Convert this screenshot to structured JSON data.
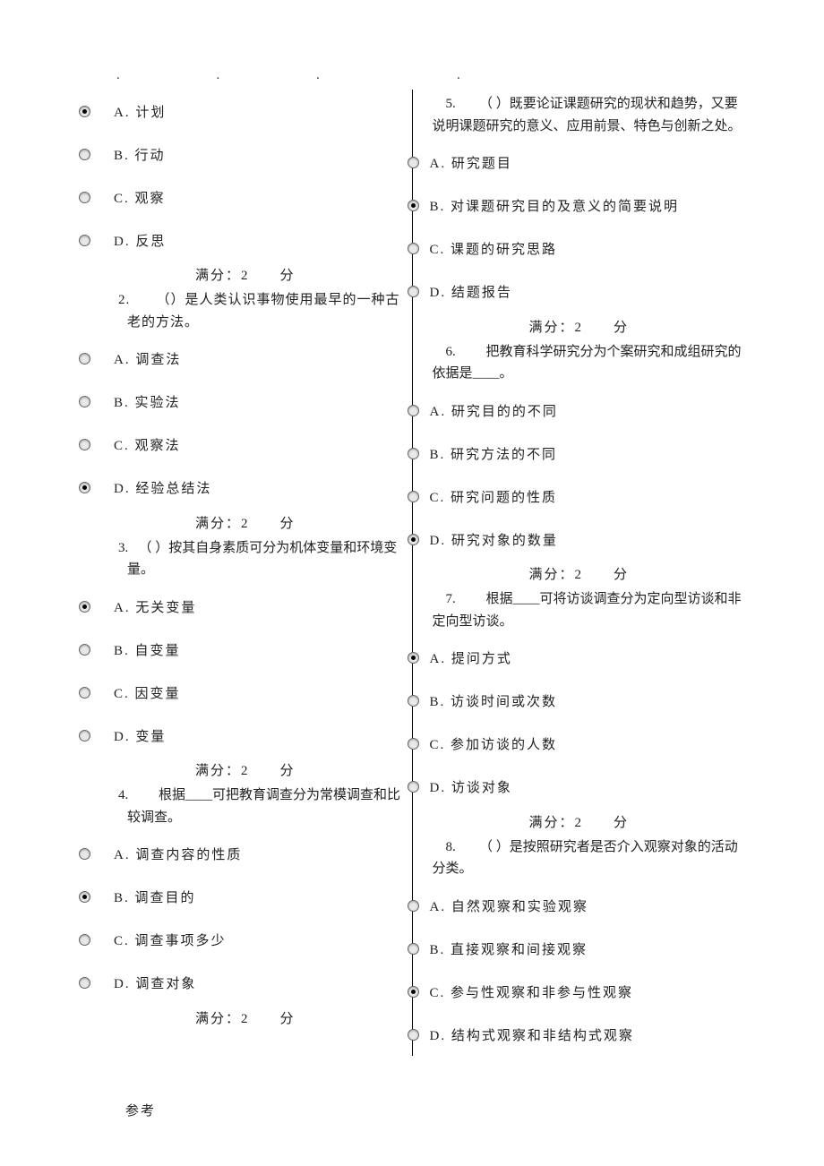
{
  "score_line": "满分：2　　分",
  "footer": "参考",
  "left": {
    "q1": {
      "opts": [
        "A.  计划",
        "B.  行动",
        "C.  观察",
        "D.  反思"
      ],
      "selected": 0
    },
    "q2": {
      "stem": "2. 　　（）是人类认识事物使用最早的一种古老的方法。",
      "opts": [
        "A.  调查法",
        "B.  实验法",
        "C.  观察法",
        "D.  经验总结法"
      ],
      "selected": 3
    },
    "q3": {
      "stem": "3. 　（ ）按其自身素质可分为机体变量和环境变量。",
      "opts": [
        "A.  无关变量",
        "B.  自变量",
        "C.  因变量",
        "D.  变量"
      ],
      "selected": 0
    },
    "q4": {
      "stem": "4. 　　根据____可把教育调查分为常模调查和比较调查。",
      "opts": [
        "A.  调查内容的性质",
        "B.  调查目的",
        "C.  调查事项多少",
        "D.  调查对象"
      ],
      "selected": 1
    }
  },
  "right": {
    "q5": {
      "stem": "　5. 　　（ ）既要论证课题研究的现状和趋势，又要说明课题研究的意义、应用前景、特色与创新之处。",
      "opts": [
        "A.  研究题目",
        "B.  对课题研究目的及意义的简要说明",
        "C.  课题的研究思路",
        "D.  结题报告"
      ],
      "selected": 1
    },
    "q6": {
      "stem": "　6. 　　把教育科学研究分为个案研究和成组研究的依据是____。",
      "opts": [
        "A.  研究目的的不同",
        "B.  研究方法的不同",
        "C.  研究问题的性质",
        "D.  研究对象的数量"
      ],
      "selected": 3
    },
    "q7": {
      "stem": "　7. 　　根据____可将访谈调查分为定向型访谈和非定向型访谈。",
      "opts": [
        "A.  提问方式",
        "B.  访谈时间或次数",
        "C.  参加访谈的人数",
        "D.  访谈对象"
      ],
      "selected": 0
    },
    "q8": {
      "stem": "　8. 　　（ ）是按照研究者是否介入观察对象的活动分类。",
      "opts": [
        "A.  自然观察和实验观察",
        "B.  直接观察和间接观察",
        "C.  参与性观察和非参与性观察",
        "D.  结构式观察和非结构式观察"
      ],
      "selected": 2
    }
  }
}
